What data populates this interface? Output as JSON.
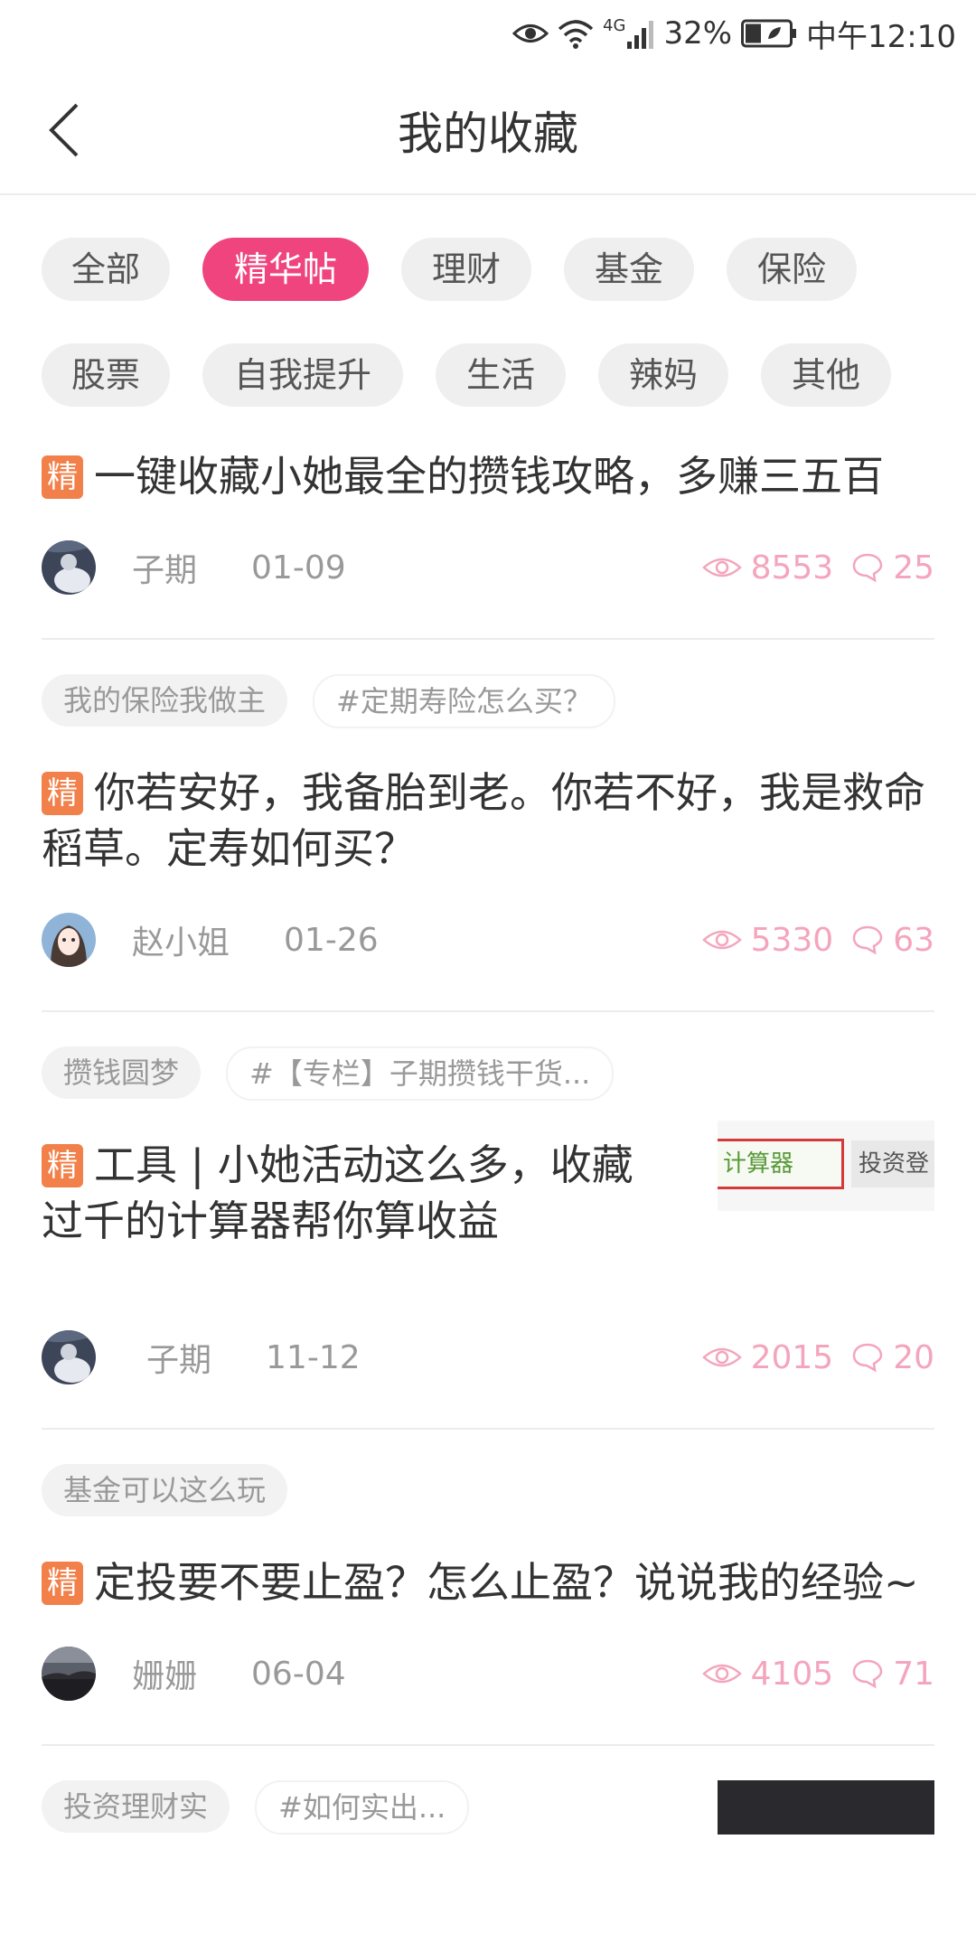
{
  "status_bar": {
    "network": "4G",
    "battery": "32%",
    "time": "中午12:10"
  },
  "header": {
    "title": "我的收藏"
  },
  "filters": {
    "row1": [
      {
        "label": "全部",
        "active": false
      },
      {
        "label": "精华帖",
        "active": true
      },
      {
        "label": "理财",
        "active": false
      },
      {
        "label": "基金",
        "active": false
      },
      {
        "label": "保险",
        "active": false
      }
    ],
    "row2": [
      {
        "label": "股票",
        "active": false
      },
      {
        "label": "自我提升",
        "active": false
      },
      {
        "label": "生活",
        "active": false
      },
      {
        "label": "辣妈",
        "active": false
      },
      {
        "label": "其他",
        "active": false
      }
    ]
  },
  "badge": "精",
  "posts": [
    {
      "tags": [],
      "title": "一键收藏小她最全的攒钱攻略，多赚三五百",
      "author": "子期",
      "date": "01-09",
      "views": "8553",
      "comments": "25"
    },
    {
      "tags": [
        "我的保险我做主",
        "#定期寿险怎么买？"
      ],
      "title": "你若安好，我备胎到老。你若不好，我是救命稻草。定寿如何买？",
      "author": "赵小姐",
      "date": "01-26",
      "views": "5330",
      "comments": "63"
    },
    {
      "tags": [
        "攒钱圆梦",
        "#【专栏】子期攒钱干货..."
      ],
      "title": "工具 | 小她活动这么多，收藏过千的计算器帮你算收益",
      "author": "子期",
      "date": "11-12",
      "views": "2015",
      "comments": "20",
      "thumb": {
        "text_left": "计算器",
        "text_right": "投资登"
      }
    },
    {
      "tags": [
        "基金可以这么玩"
      ],
      "title": "定投要不要止盈？怎么止盈？说说我的经验~",
      "author": "姗姗",
      "date": "06-04",
      "views": "4105",
      "comments": "71"
    },
    {
      "tags": [
        "投资理财实",
        "#如何实出..."
      ]
    }
  ],
  "colors": {
    "accent": "#f0447e",
    "badge": "#f2804a",
    "stats": "#f4a5bd"
  }
}
